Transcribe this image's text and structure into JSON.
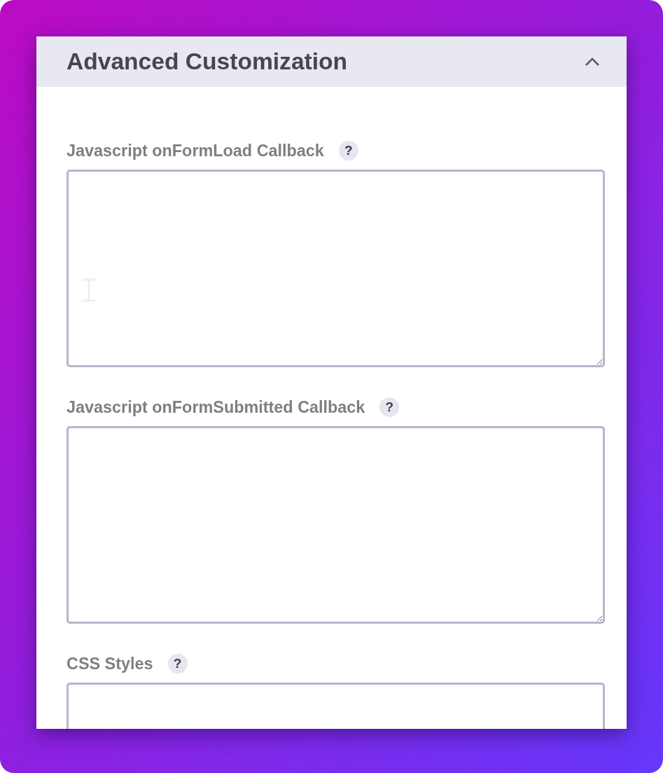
{
  "panel": {
    "title": "Advanced Customization",
    "expanded": true
  },
  "fields": [
    {
      "label": "Javascript onFormLoad Callback",
      "help": "?",
      "hovered": true
    },
    {
      "label": "Javascript onFormSubmitted Callback",
      "help": "?",
      "hovered": false
    },
    {
      "label": "CSS Styles",
      "help": "?",
      "hovered": false
    }
  ]
}
